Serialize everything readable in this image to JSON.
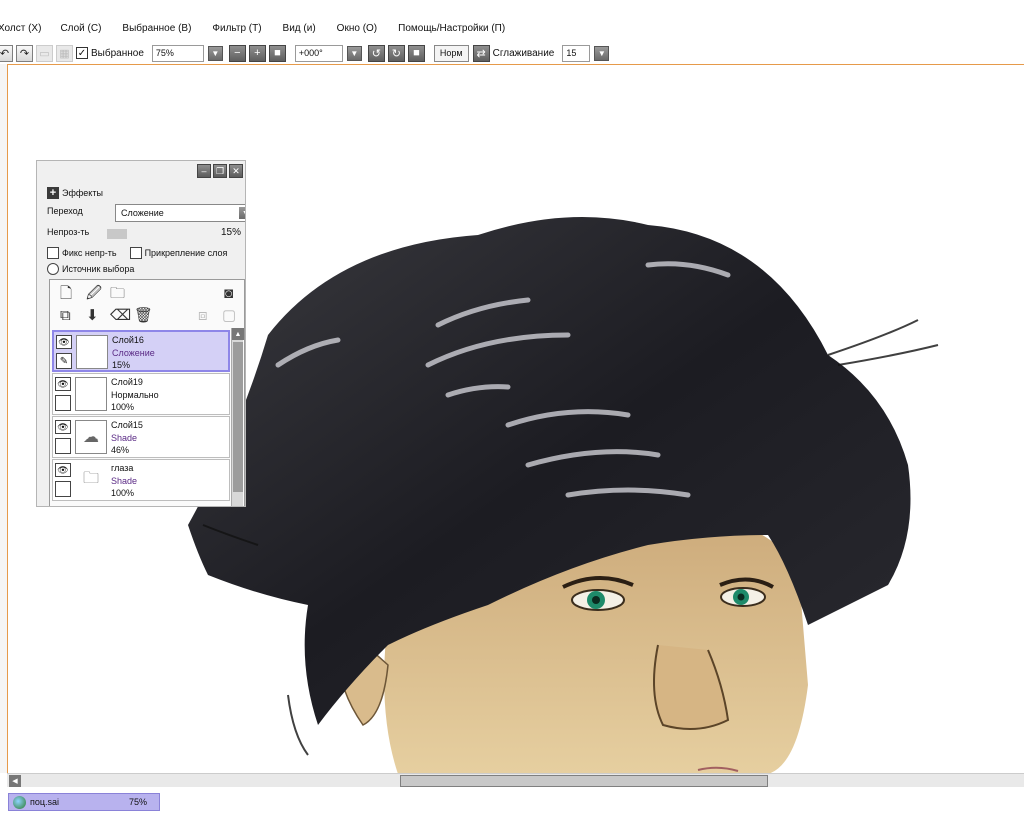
{
  "menu": [
    "Холст (X)",
    "Слой (C)",
    "Выбранное (B)",
    "Фильтр (T)",
    "Вид (и)",
    "Окно (O)",
    "Помощь/Настройки (П)"
  ],
  "toolbar": {
    "selection_check_label": "Выбранное",
    "zoom_value": "75%",
    "rotation_value": "+000°",
    "mode_label": "Норм",
    "smoothing_label": "Сглаживание",
    "smoothing_value": "15"
  },
  "layer_panel": {
    "effects_label": "Эффекты",
    "blend_label": "Переход",
    "blend_value": "Сложение",
    "opacity_label": "Непроз-ть",
    "opacity_value": "15%",
    "opacity_fraction": 0.15,
    "fix_opacity_label": "Фикс непр-ть",
    "clip_layer_label": "Прикрепление слоя",
    "selection_source_label": "Источник выбора",
    "layers": [
      {
        "name": "Слой16",
        "mode": "Сложение",
        "opacity": "15%",
        "selected": true
      },
      {
        "name": "Слой19",
        "mode": "Нормально",
        "opacity": "100%",
        "selected": false
      },
      {
        "name": "Слой15",
        "mode": "Shade",
        "opacity": "46%",
        "selected": false
      },
      {
        "name": "глаза",
        "mode": "Shade",
        "opacity": "100%",
        "selected": false
      }
    ]
  },
  "statusbar": {
    "document_name": "поц.sai",
    "document_zoom": "75%"
  },
  "colors": {
    "accent_border": "#e69a4a",
    "selected_layer": "#d4d0f6",
    "blend_mode_text": "#5a2a85"
  }
}
